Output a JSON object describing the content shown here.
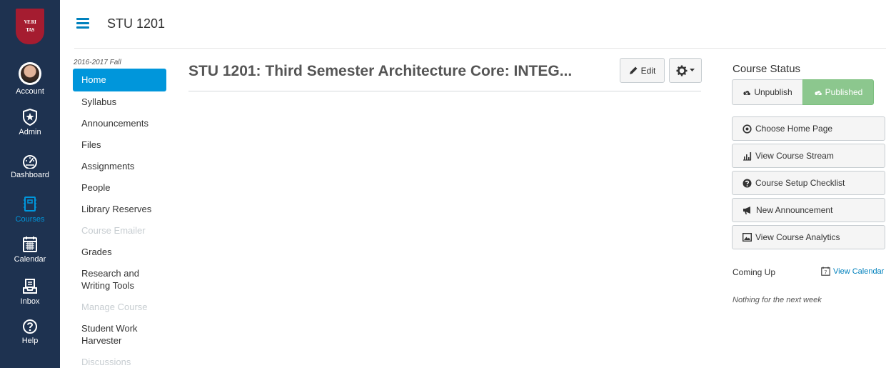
{
  "global_nav": {
    "logo_text": [
      "VE RI",
      "TAS"
    ],
    "items": [
      {
        "label": "Account",
        "icon": "avatar"
      },
      {
        "label": "Admin",
        "icon": "shield-star-icon"
      },
      {
        "label": "Dashboard",
        "icon": "speedometer-icon"
      },
      {
        "label": "Courses",
        "icon": "book-icon"
      },
      {
        "label": "Calendar",
        "icon": "calendar-icon"
      },
      {
        "label": "Inbox",
        "icon": "inbox-icon"
      },
      {
        "label": "Help",
        "icon": "question-icon"
      }
    ],
    "active_color": "#0096db",
    "bg_color": "#1e3250"
  },
  "header": {
    "course_code": "STU 1201"
  },
  "course_nav": {
    "term": "2016-2017 Fall",
    "items": [
      {
        "label": "Home",
        "state": "active"
      },
      {
        "label": "Syllabus",
        "state": "normal"
      },
      {
        "label": "Announcements",
        "state": "normal"
      },
      {
        "label": "Files",
        "state": "normal"
      },
      {
        "label": "Assignments",
        "state": "normal"
      },
      {
        "label": "People",
        "state": "normal"
      },
      {
        "label": "Library Reserves",
        "state": "normal"
      },
      {
        "label": "Course Emailer",
        "state": "disabled"
      },
      {
        "label": "Grades",
        "state": "normal"
      },
      {
        "label": "Research and Writing Tools",
        "state": "normal"
      },
      {
        "label": "Manage Course",
        "state": "disabled"
      },
      {
        "label": "Student Work Harvester",
        "state": "normal"
      },
      {
        "label": "Discussions",
        "state": "disabled"
      }
    ]
  },
  "main": {
    "title": "STU 1201: Third Semester Architecture Core: INTEG...",
    "edit_label": "Edit"
  },
  "aside": {
    "status_title": "Course Status",
    "unpublish_label": "Unpublish",
    "published_label": "Published",
    "actions": [
      {
        "label": "Choose Home Page",
        "icon": "target-icon"
      },
      {
        "label": "View Course Stream",
        "icon": "bar-chart-icon"
      },
      {
        "label": "Course Setup Checklist",
        "icon": "question-circle-icon"
      },
      {
        "label": "New Announcement",
        "icon": "megaphone-icon"
      },
      {
        "label": "View Course Analytics",
        "icon": "image-icon"
      }
    ],
    "coming_up": "Coming Up",
    "view_calendar": "View Calendar",
    "calendar_day": "7",
    "nothing_text": "Nothing for the next week"
  }
}
